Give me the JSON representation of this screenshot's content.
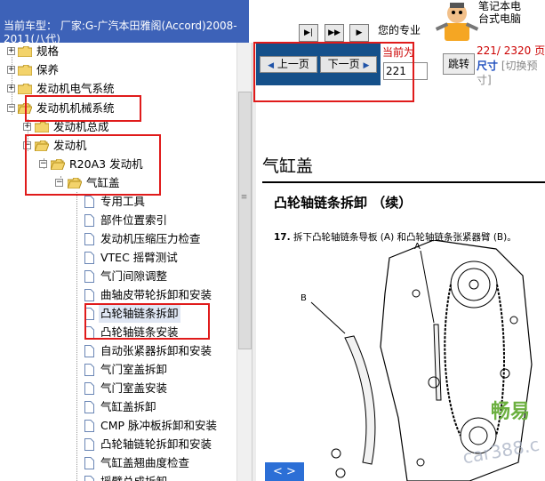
{
  "header": {
    "vehicle_text": "当前车型： 厂家:G-广汽本田雅阁(Accord)2008-2011(八代)"
  },
  "toolbar": {
    "btn_first": "▶|",
    "btn_mid": "▶▶",
    "btn_last": "▶",
    "profile_text": "您的专业",
    "ad_line1": "笔记本电",
    "ad_line2": "台式电脑"
  },
  "nav": {
    "prev_label": "上一页",
    "next_label": "下一页",
    "current_label": "当前为",
    "page_value": "221",
    "jump_label": "跳转",
    "page_info": "221/ 2320 页",
    "size_label": "尺寸",
    "size_options": "[切换预",
    "size_trail": "寸]"
  },
  "tree": {
    "nodes": [
      {
        "label": "规格"
      },
      {
        "label": "保养"
      },
      {
        "label": "发动机电气系统"
      },
      {
        "label": "发动机机械系统"
      },
      {
        "label": "发动机总成"
      },
      {
        "label": "发动机"
      },
      {
        "label": "R20A3 发动机"
      },
      {
        "label": "气缸盖"
      },
      {
        "label": "专用工具"
      },
      {
        "label": "部件位置索引"
      },
      {
        "label": "发动机压缩压力检查"
      },
      {
        "label": "VTEC 摇臂测试"
      },
      {
        "label": "气门间隙调整"
      },
      {
        "label": "曲轴皮带轮拆卸和安装"
      },
      {
        "label": "凸轮轴链条拆卸"
      },
      {
        "label": "凸轮轴链条安装"
      },
      {
        "label": "自动张紧器拆卸和安装"
      },
      {
        "label": "气门室盖拆卸"
      },
      {
        "label": "气门室盖安装"
      },
      {
        "label": "气缸盖拆卸"
      },
      {
        "label": "CMP 脉冲板拆卸和安装"
      },
      {
        "label": "凸轮轴链轮拆卸和安装"
      },
      {
        "label": "气缸盖翘曲度检查"
      },
      {
        "label": "摇臂总成拆卸"
      }
    ]
  },
  "document": {
    "title": "气缸盖",
    "subtitle": "凸轮轴链条拆卸 （续）",
    "step_number": "17.",
    "step_text": "拆下凸轮轴链条导板 (A) 和凸轮轴链条张紧器臂 (B)。",
    "callout_a": "A",
    "callout_b": "B"
  },
  "overlay": {
    "nav_arrows": "< >",
    "watermark_1": "畅易",
    "watermark_2": "car388.c"
  }
}
